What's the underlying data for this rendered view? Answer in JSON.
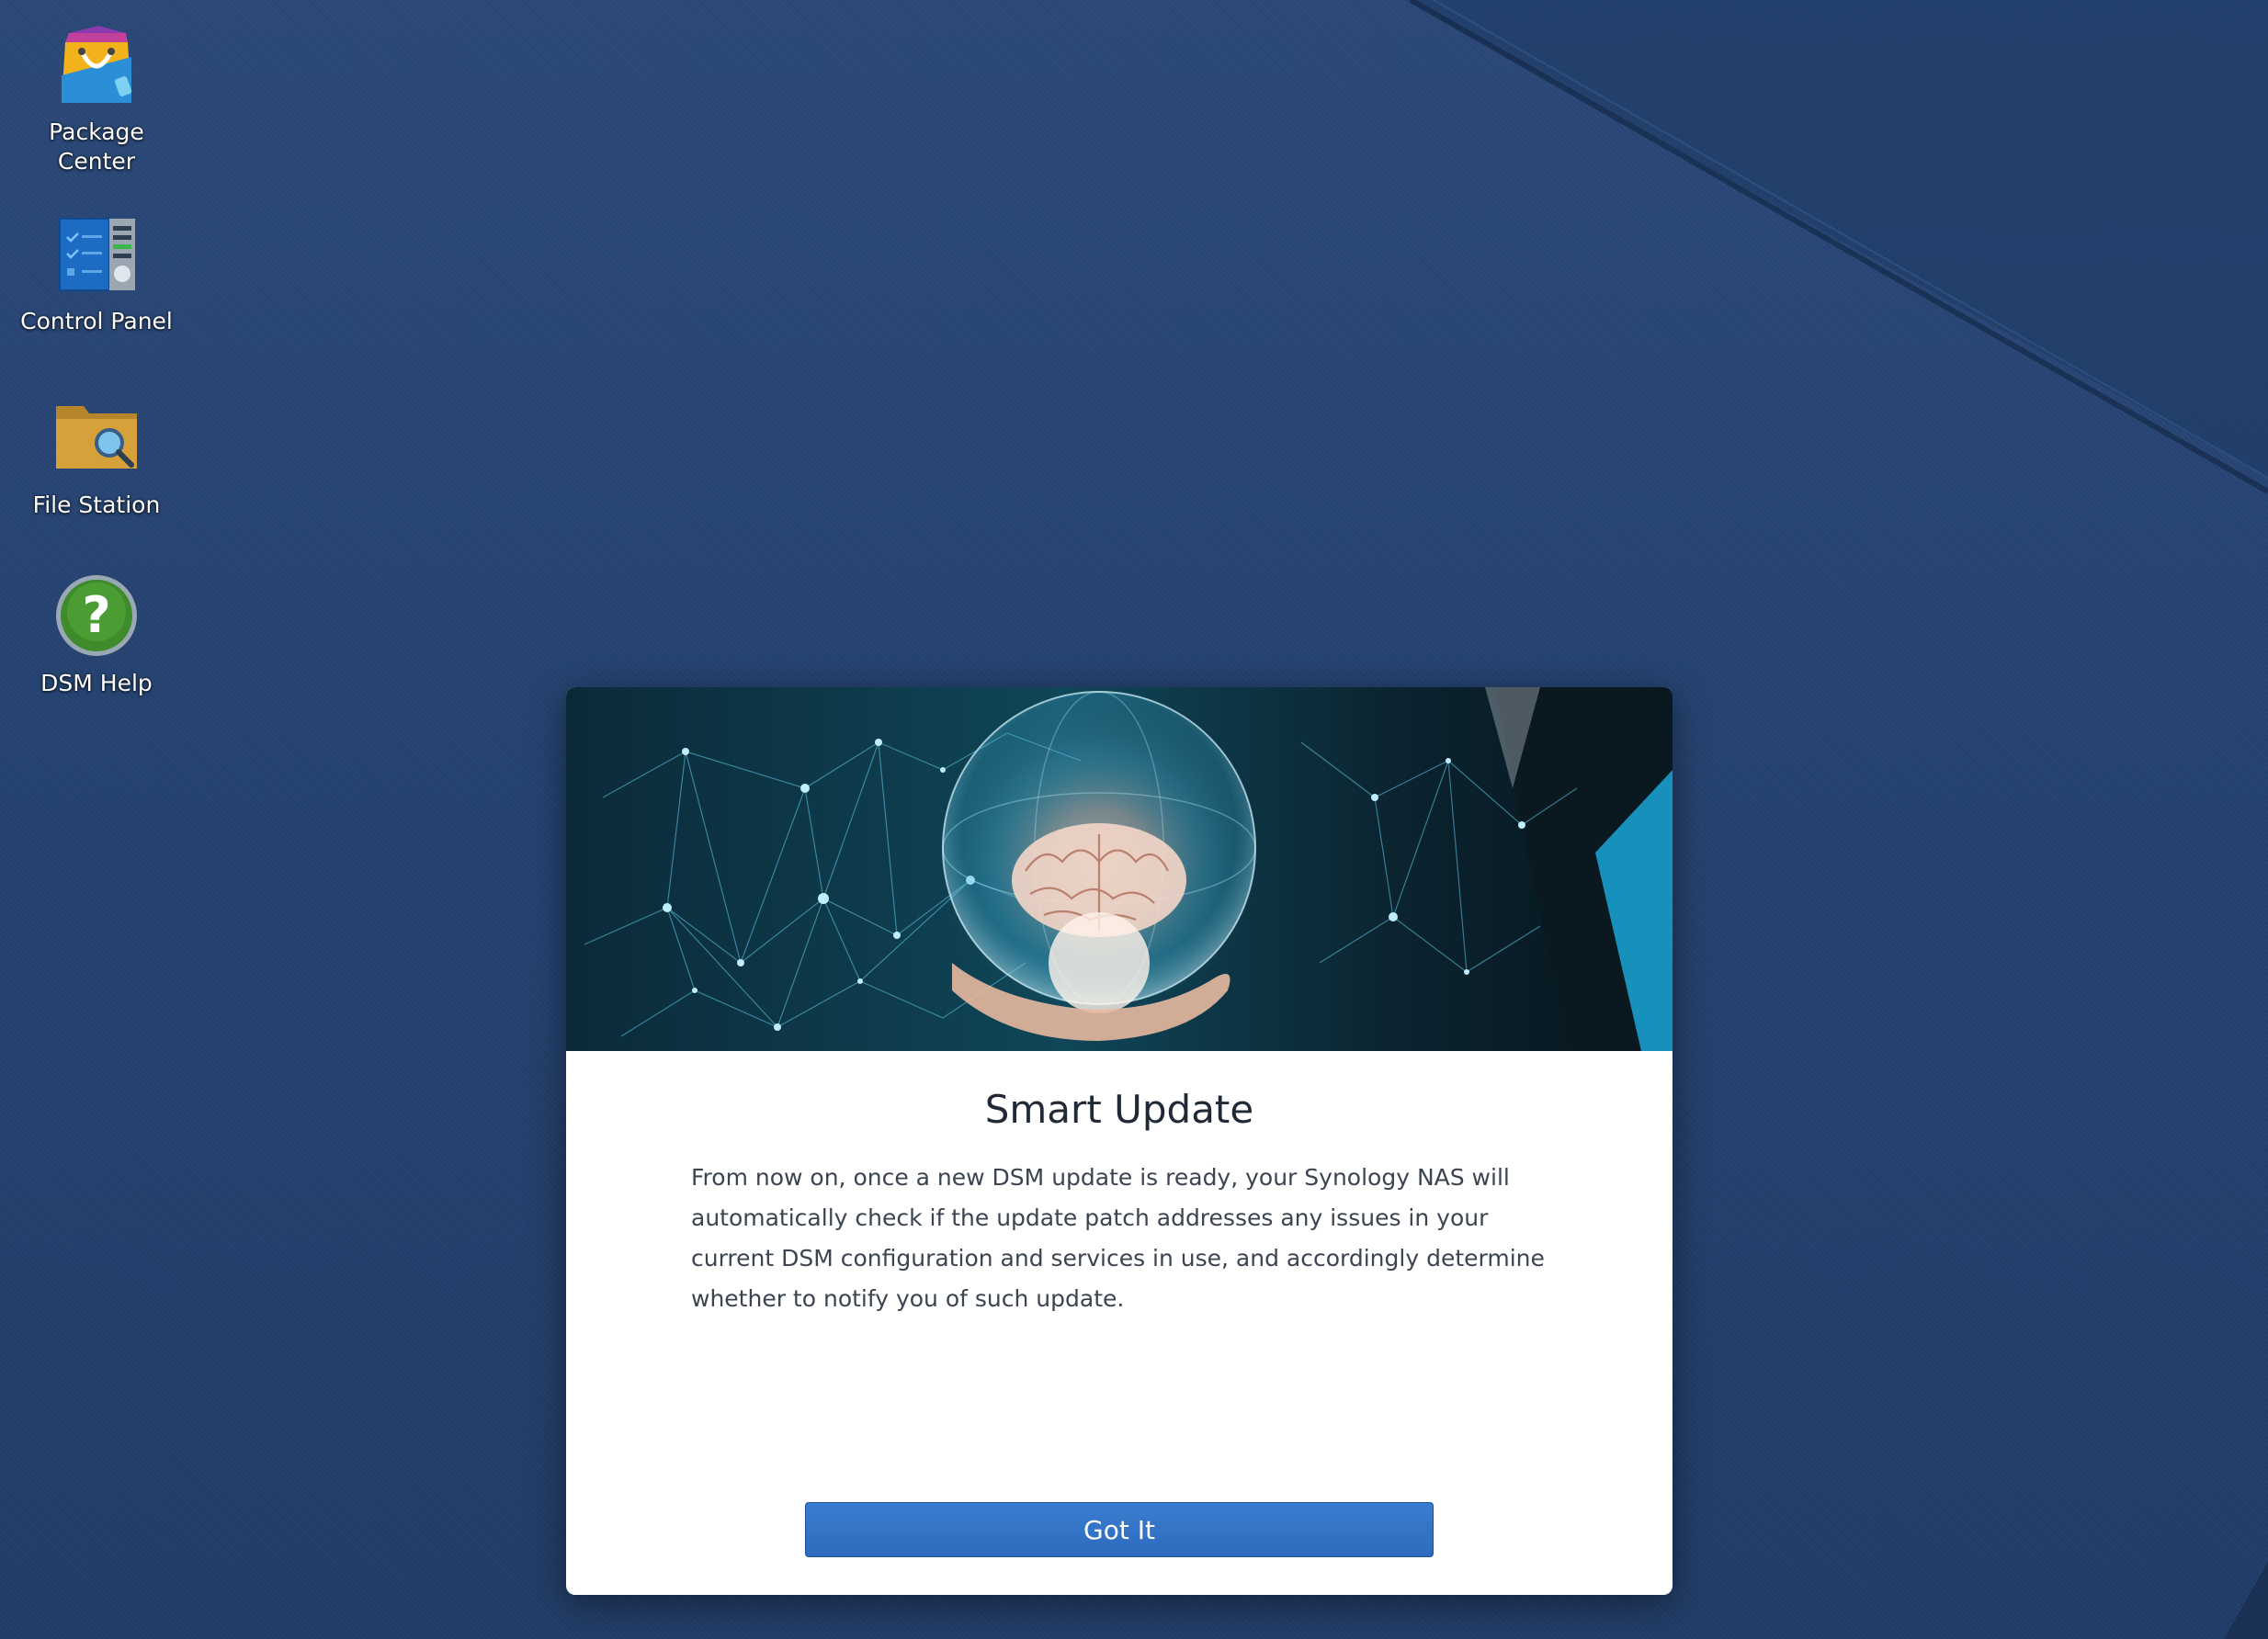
{
  "desktop": {
    "icons": [
      {
        "label": "Package\nCenter",
        "icon": "package-center-icon"
      },
      {
        "label": "Control Panel",
        "icon": "control-panel-icon"
      },
      {
        "label": "File Station",
        "icon": "file-station-icon"
      },
      {
        "label": "DSM Help",
        "icon": "dsm-help-icon"
      }
    ]
  },
  "dialog": {
    "title": "Smart Update",
    "body": "From now on, once a new DSM update is ready, your Synology NAS will automatically check if the update patch addresses any issues in your current DSM configuration and services in use, and accordingly determine whether to notify you of such update.",
    "button_label": "Got It",
    "hero_image": "brain-globe-network-illustration"
  },
  "colors": {
    "desktop_background": "#24416f",
    "dialog_background": "#ffffff",
    "button_primary": "#2d6bbd",
    "title_text": "#1f2a36",
    "body_text": "#3b4450"
  }
}
